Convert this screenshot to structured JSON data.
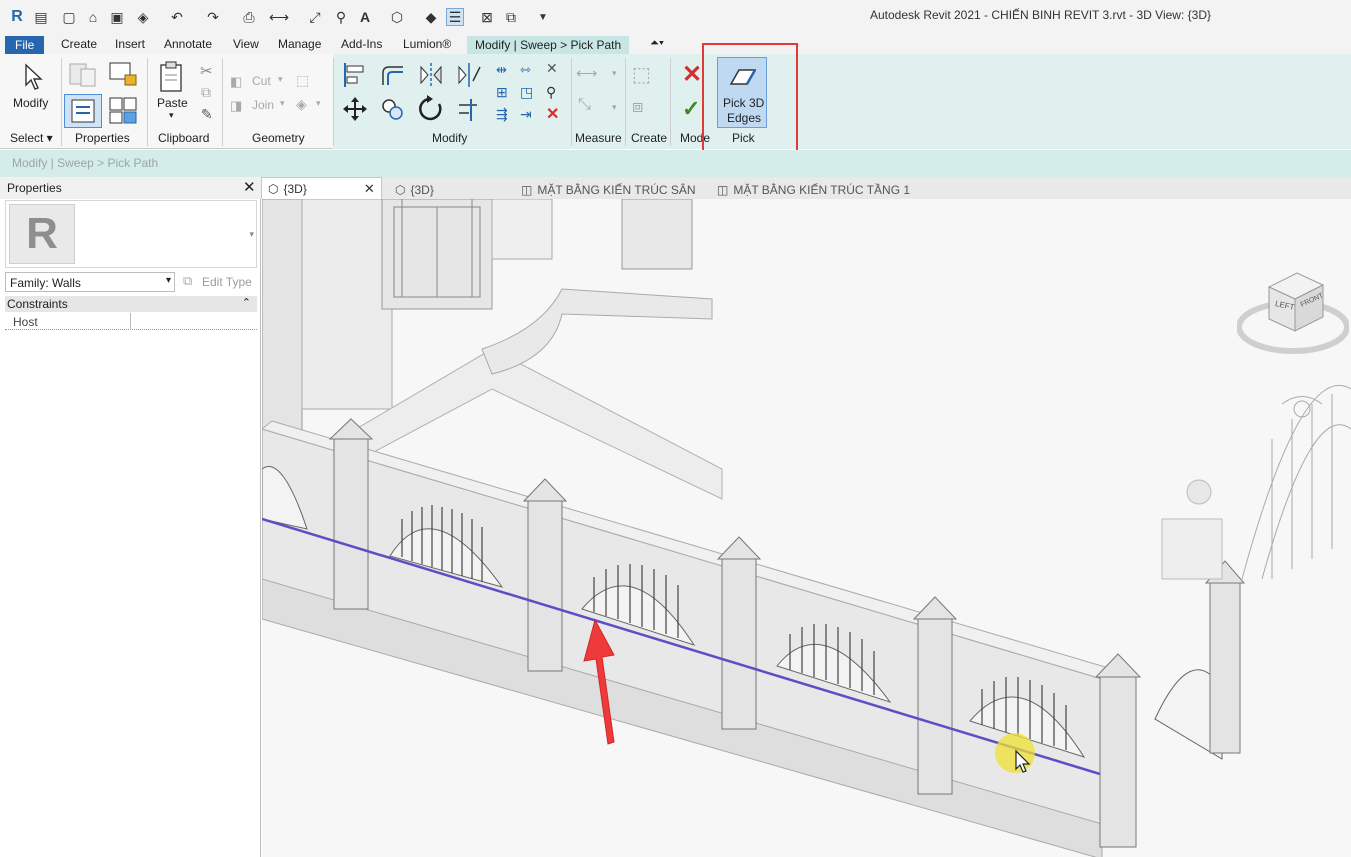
{
  "window": {
    "title": "Autodesk Revit 2021 - CHIẾN BINH REVIT 3.rvt - 3D View: {3D}"
  },
  "ribbon_tabs": [
    {
      "label": "File"
    },
    {
      "label": "Create"
    },
    {
      "label": "Insert"
    },
    {
      "label": "Annotate"
    },
    {
      "label": "View"
    },
    {
      "label": "Manage"
    },
    {
      "label": "Add-Ins"
    },
    {
      "label": "Lumion®"
    },
    {
      "label": "Modify | Sweep > Pick Path"
    }
  ],
  "ribbon": {
    "select": {
      "modify_label": "Modify",
      "panel_label": "Select ▾"
    },
    "properties": {
      "panel_label": "Properties"
    },
    "clipboard": {
      "paste_label": "Paste",
      "panel_label": "Clipboard"
    },
    "geometry": {
      "cut_label": "Cut",
      "join_label": "Join",
      "panel_label": "Geometry"
    },
    "modify": {
      "panel_label": "Modify"
    },
    "measure": {
      "panel_label": "Measure"
    },
    "create": {
      "panel_label": "Create"
    },
    "mode": {
      "panel_label": "Mode"
    },
    "pick": {
      "button_line1": "Pick 3D",
      "button_line2": "Edges",
      "panel_label": "Pick"
    }
  },
  "breadcrumb": "Modify | Sweep > Pick Path",
  "properties_palette": {
    "title": "Properties",
    "family_selector": "Family: Walls",
    "edit_type_label": "Edit Type",
    "section_constraints": "Constraints",
    "rows": [
      {
        "name": "Host",
        "value": ""
      }
    ]
  },
  "view_tabs": [
    {
      "label": "{3D}",
      "active": true
    },
    {
      "label": "{3D}",
      "active": false
    },
    {
      "label": "MẶT BẰNG KIẾN TRÚC SÂN",
      "active": false
    },
    {
      "label": "MẶT BẰNG KIẾN TRÚC TẦNG 1",
      "active": false
    }
  ],
  "viewcube": {
    "left_label": "LEFT",
    "front_label": "FRONT"
  },
  "colors": {
    "accent": "#2765ae",
    "ctx_tab": "#c8e7e4",
    "highlight_box": "#e03a3a",
    "pick_path_line": "#5a4fc4",
    "arrow": "#ee3a3a"
  }
}
